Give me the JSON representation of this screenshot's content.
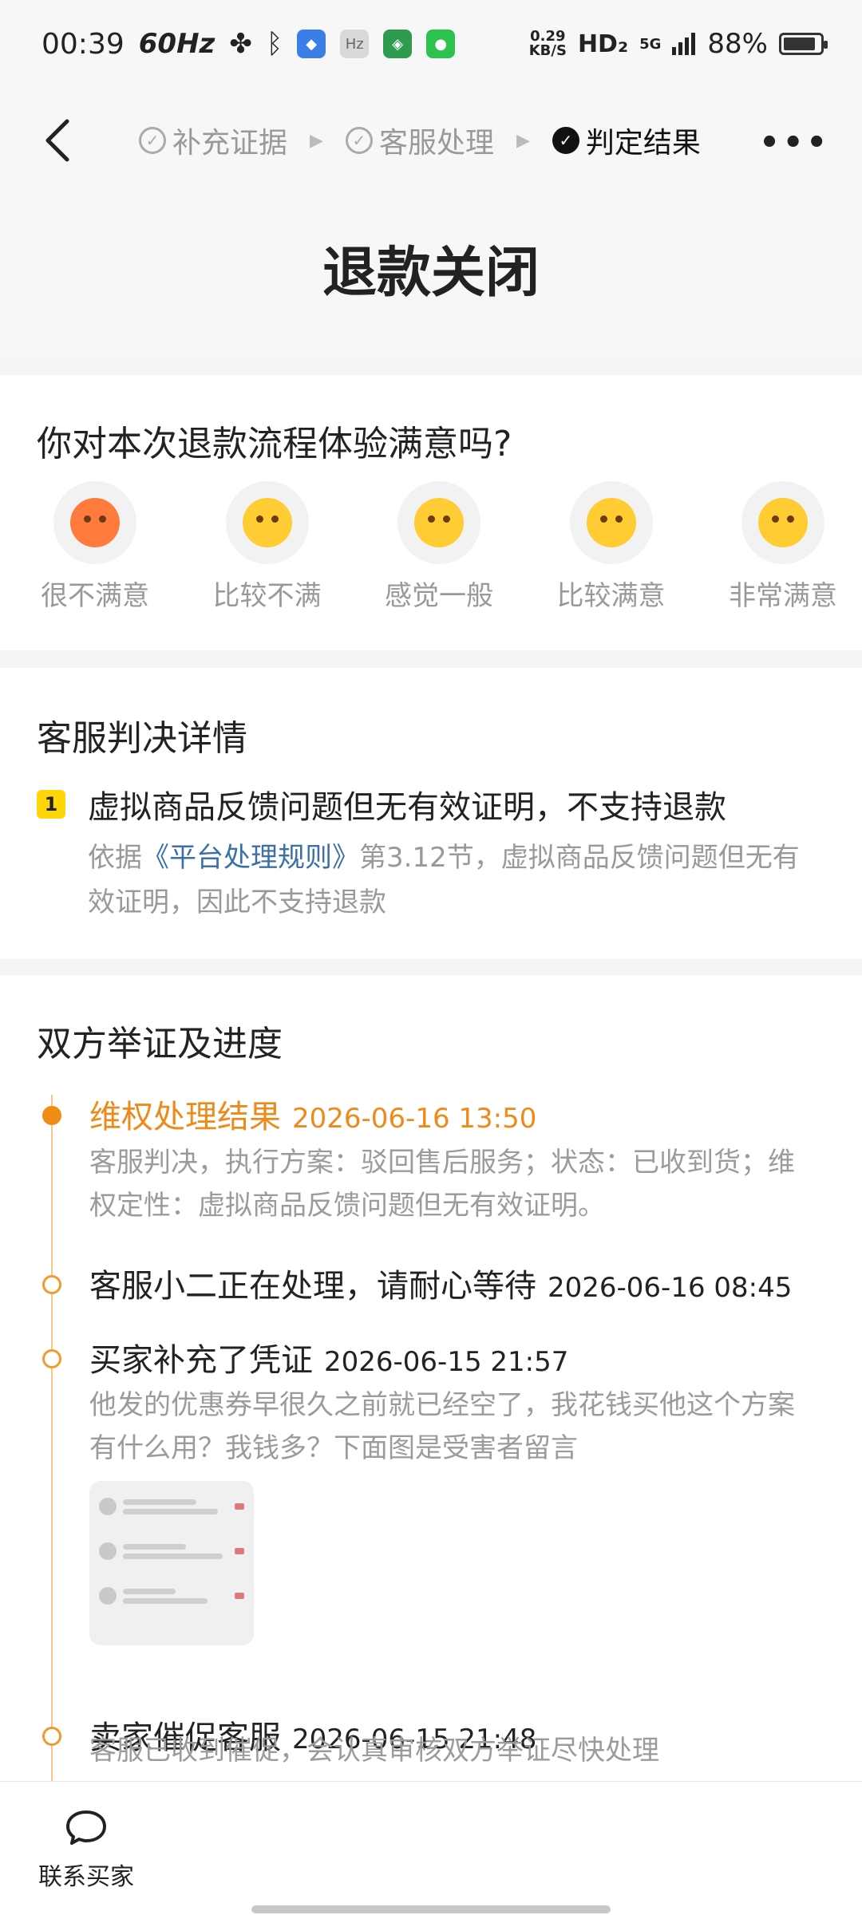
{
  "status_bar": {
    "time": "00:39",
    "refresh": "60Hz",
    "speed_top": "0.29",
    "speed_bottom": "KB/S",
    "hd": "HD₂",
    "network": "5G",
    "battery": "88%",
    "battery_level": 0.88
  },
  "nav": {
    "steps": [
      {
        "label": "补充证据",
        "state": "done"
      },
      {
        "label": "客服处理",
        "state": "done"
      },
      {
        "label": "判定结果",
        "state": "active"
      }
    ],
    "more": "•••"
  },
  "headline": "退款关闭",
  "survey": {
    "question": "你对本次退款流程体验满意吗?",
    "options": [
      {
        "label": "很不满意",
        "icon": "angry-face-icon"
      },
      {
        "label": "比较不满",
        "icon": "unamused-face-icon"
      },
      {
        "label": "感觉一般",
        "icon": "neutral-face-icon"
      },
      {
        "label": "比较满意",
        "icon": "blushing-face-icon"
      },
      {
        "label": "非常满意",
        "icon": "kissing-face-icon"
      }
    ]
  },
  "verdict": {
    "title": "客服判决详情",
    "badge": "1",
    "rule_title": "虚拟商品反馈问题但无有效证明，不支持退款",
    "desc_prefix": "依据",
    "desc_link": "《平台处理规则》",
    "desc_suffix": "第3.12节，虚拟商品反馈问题但无有效证明，因此不支持退款"
  },
  "timeline": {
    "title": "双方举证及进度",
    "items": [
      {
        "title": "维权处理结果",
        "time": "2026-06-16 13:50",
        "body": "客服判决，执行方案：驳回售后服务；状态：已收到货；维权定性：虚拟商品反馈问题但无有效证明。"
      },
      {
        "title": "客服小二正在处理，请耐心等待",
        "time": "2026-06-16 08:45",
        "body": ""
      },
      {
        "title": "买家补充了凭证",
        "time": "2026-06-15 21:57",
        "body": "他发的优惠券早很久之前就已经空了，我花钱买他这个方案有什么用？我钱多？下面图是受害者留言"
      },
      {
        "title": "卖家催促客服",
        "time": "2026-06-15 21:48",
        "body": "客服已收到催促，会认真审核双方举证尽快处理"
      }
    ]
  },
  "bottom": {
    "contact_label": "联系买家"
  }
}
